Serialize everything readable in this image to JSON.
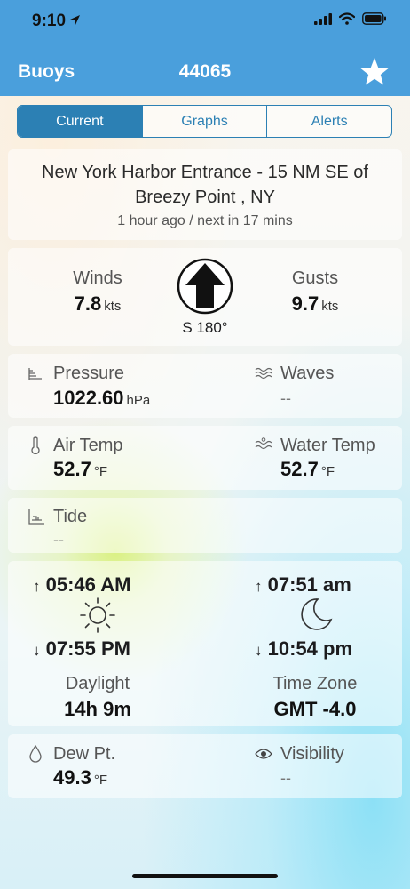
{
  "status_bar": {
    "time": "9:10"
  },
  "nav": {
    "back_label": "Buoys",
    "title": "44065"
  },
  "tabs": [
    {
      "label": "Current",
      "active": true
    },
    {
      "label": "Graphs",
      "active": false
    },
    {
      "label": "Alerts",
      "active": false
    }
  ],
  "station": {
    "name_line1": "New York Harbor Entrance - 15 NM SE of",
    "name_line2": "Breezy Point , NY",
    "updated": "1 hour ago / next in 17 mins"
  },
  "wind": {
    "winds_label": "Winds",
    "winds_value": "7.8",
    "winds_unit": "kts",
    "gusts_label": "Gusts",
    "gusts_value": "9.7",
    "gusts_unit": "kts",
    "direction": "S 180°",
    "direction_degrees": 180
  },
  "pressure": {
    "label": "Pressure",
    "value": "1022.60",
    "unit": "hPa"
  },
  "waves": {
    "label": "Waves",
    "value": "--"
  },
  "air_temp": {
    "label": "Air Temp",
    "value": "52.7",
    "unit": "°F"
  },
  "water_temp": {
    "label": "Water Temp",
    "value": "52.7",
    "unit": "°F"
  },
  "tide": {
    "label": "Tide",
    "value": "--"
  },
  "sun": {
    "rise": "05:46 AM",
    "set": "07:55 PM",
    "daylight_label": "Daylight",
    "daylight_value": "14h 9m"
  },
  "moon": {
    "rise": "07:51 am",
    "set": "10:54 pm",
    "tz_label": "Time Zone",
    "tz_value": "GMT -4.0"
  },
  "dew_point": {
    "label": "Dew Pt.",
    "value": "49.3",
    "unit": "°F"
  },
  "visibility": {
    "label": "Visibility",
    "value": "--"
  },
  "colors": {
    "nav_bar": "#4a9fdc",
    "accent": "#2c80b4"
  }
}
